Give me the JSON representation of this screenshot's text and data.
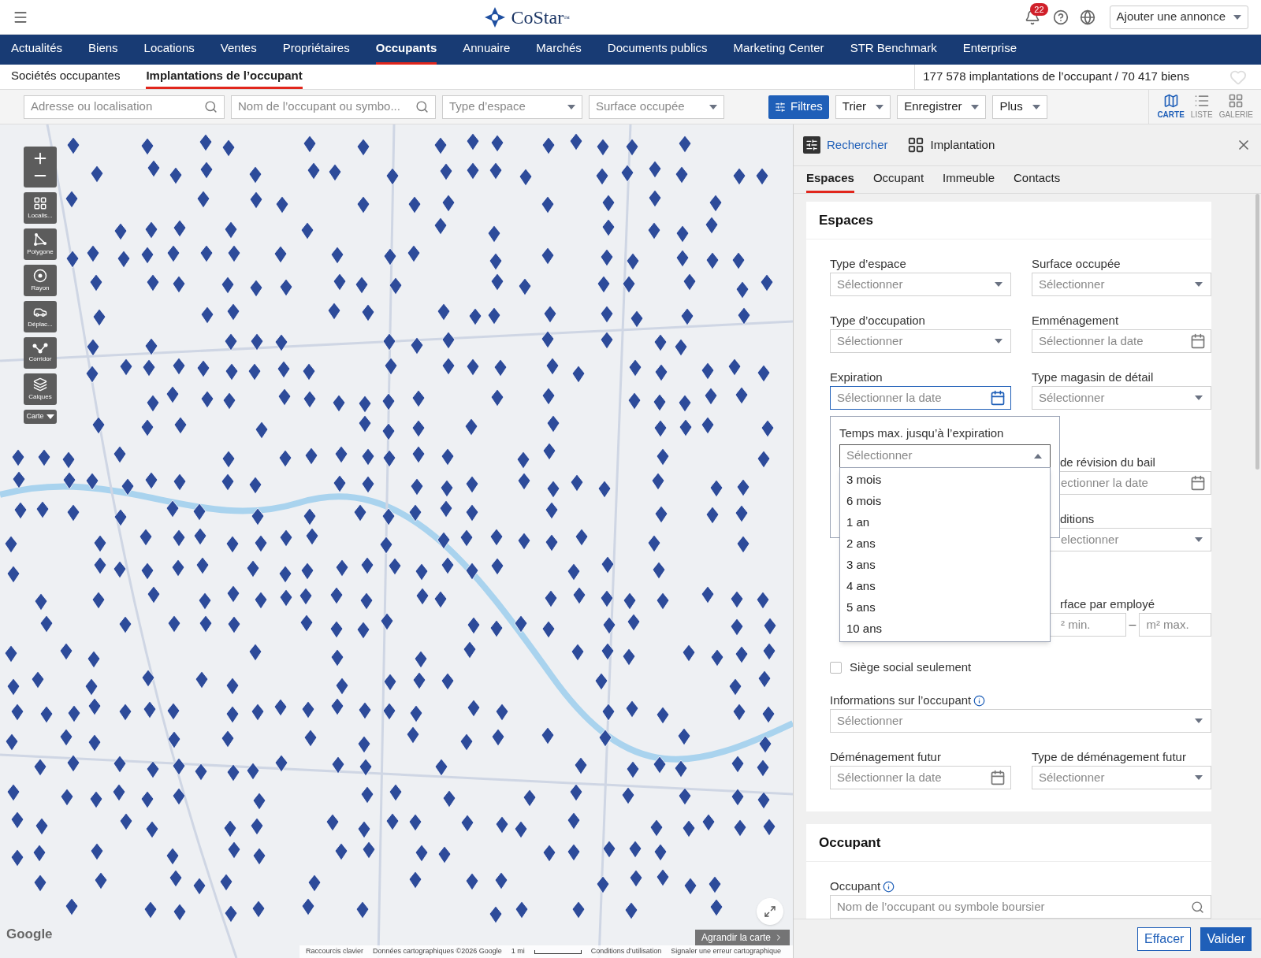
{
  "top_bar": {
    "logo": "CoStar",
    "trademark": "™",
    "notifications": "22",
    "add_listing": "Ajouter une annonce"
  },
  "nav": [
    {
      "label": "Actualités",
      "selected": false
    },
    {
      "label": "Biens",
      "selected": false
    },
    {
      "label": "Locations",
      "selected": false
    },
    {
      "label": "Ventes",
      "selected": false
    },
    {
      "label": "Propriétaires",
      "selected": false
    },
    {
      "label": "Occupants",
      "selected": true
    },
    {
      "label": "Annuaire",
      "selected": false
    },
    {
      "label": "Marchés",
      "selected": false
    },
    {
      "label": "Documents publics",
      "selected": false
    },
    {
      "label": "Marketing Center",
      "selected": false
    },
    {
      "label": "STR Benchmark",
      "selected": false
    },
    {
      "label": "Enterprise",
      "selected": false
    }
  ],
  "sub_tabs": [
    {
      "label": "Sociétés occupantes",
      "selected": false
    },
    {
      "label": "Implantations de l’occupant",
      "selected": true
    }
  ],
  "result_count": "177 578 implantations de l’occupant / 70 417 biens",
  "filter_bar": {
    "fields": [
      {
        "kind": "search",
        "placeholder": "Adresse ou localisation"
      },
      {
        "kind": "search",
        "placeholder": "Nom de l’occupant ou symbo..."
      },
      {
        "kind": "select",
        "placeholder": "Type d’espace"
      },
      {
        "kind": "select",
        "placeholder": "Surface occupée"
      }
    ],
    "filters_button": "Filtres",
    "menus": [
      "Trier",
      "Enregistrer",
      "Plus"
    ],
    "views": [
      {
        "kind": "map",
        "label": "CARTE",
        "selected": true
      },
      {
        "kind": "list",
        "label": "LISTE",
        "selected": false
      },
      {
        "kind": "gallery",
        "label": "GALERIE",
        "selected": false
      }
    ]
  },
  "map": {
    "tools": [
      {
        "kind": "locate",
        "label": "Localis..."
      },
      {
        "kind": "polygon",
        "label": "Polygone"
      },
      {
        "kind": "radius",
        "label": "Rayon"
      },
      {
        "kind": "drive",
        "label": "Déplac..."
      },
      {
        "kind": "corridor",
        "label": "Corridor"
      },
      {
        "kind": "layers",
        "label": "Calques"
      }
    ],
    "layer_menu": "Carte",
    "google": "Google",
    "footer": [
      "Raccourcis clavier",
      "Données cartographiques ©2026 Google"
    ],
    "scale": "1 mi",
    "footer_right": [
      "Conditions d’utilisation",
      "Signaler une erreur cartographique"
    ],
    "expand": "Agrandir la carte"
  },
  "panel": {
    "modes": [
      {
        "kind": "search",
        "label": "Rechercher",
        "selected": true
      },
      {
        "kind": "location",
        "label": "Implantation",
        "selected": false
      }
    ],
    "tabs": [
      {
        "label": "Espaces",
        "selected": true
      },
      {
        "label": "Occupant",
        "selected": false
      },
      {
        "label": "Immeuble",
        "selected": false
      },
      {
        "label": "Contacts",
        "selected": false
      }
    ],
    "sections": [
      {
        "title": "Espaces",
        "rows": [
          [
            {
              "kind": "select",
              "label": "Type d’espace",
              "placeholder": "Sélectionner"
            },
            {
              "kind": "select",
              "label": "Surface occupée",
              "placeholder": "Sélectionner"
            }
          ],
          [
            {
              "kind": "select",
              "label": "Type d’occupation",
              "placeholder": "Sélectionner"
            },
            {
              "kind": "date",
              "label": "Emménagement",
              "placeholder": "Sélectionner la date",
              "focused": false
            }
          ],
          [
            {
              "kind": "date",
              "label": "Expiration",
              "placeholder": "Sélectionner la date",
              "focused": true
            },
            {
              "kind": "select",
              "label": "Type magasin de détail",
              "placeholder": "Sélectionner"
            }
          ],
          [
            {
              "kind": "date",
              "label": "de révision du bail",
              "placeholder": "ectionner la date",
              "covered": true,
              "focused": false
            }
          ],
          [
            {
              "kind": "select",
              "label": "ditions",
              "placeholder": "electionner",
              "covered": true
            }
          ],
          [
            {
              "kind": "range",
              "label": "rface par employé",
              "min": "² min.",
              "separator": "–",
              "max": "m² max.",
              "covered": true
            }
          ],
          [
            {
              "kind": "checkbox",
              "label": "Siège social seulement",
              "checked": false
            }
          ],
          [
            {
              "kind": "select",
              "label": "Informations sur l’occupant",
              "placeholder": "Sélectionner",
              "info": true
            }
          ],
          [
            {
              "kind": "date",
              "label": "Déménagement futur",
              "placeholder": "Sélectionner la date",
              "focused": false
            },
            {
              "kind": "select",
              "label": "Type de déménagement futur",
              "placeholder": "Sélectionner"
            }
          ]
        ],
        "popup": {
          "label": "Temps max. jusqu’à l’expiration",
          "placeholder": "Sélectionner",
          "expanded": true,
          "options": [
            {
              "label": "3 mois",
              "selected": false
            },
            {
              "label": "6 mois",
              "selected": false
            },
            {
              "label": "1 an",
              "selected": false
            },
            {
              "label": "2 ans",
              "selected": false
            },
            {
              "label": "3 ans",
              "selected": false
            },
            {
              "label": "4 ans",
              "selected": false
            },
            {
              "label": "5 ans",
              "selected": false
            },
            {
              "label": "10 ans",
              "selected": false
            }
          ]
        }
      },
      {
        "title": "Occupant",
        "rows": [
          [
            {
              "kind": "search",
              "label": "Occupant",
              "placeholder": "Nom de l’occupant ou symbole boursier",
              "info": true
            }
          ]
        ]
      }
    ],
    "buttons": [
      {
        "kind": "secondary",
        "label": "Effacer"
      },
      {
        "kind": "primary",
        "label": "Valider"
      }
    ]
  }
}
